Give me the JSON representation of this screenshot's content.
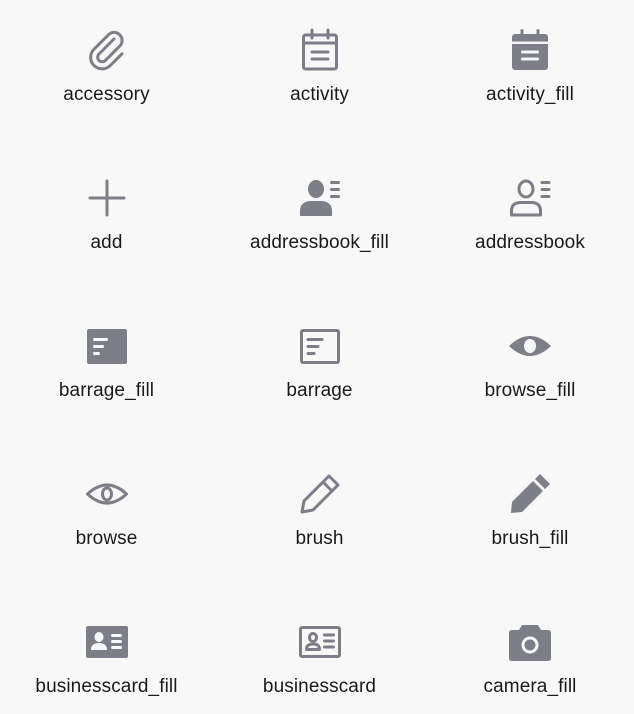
{
  "colors": {
    "background": "#f8f8f8",
    "icon": "#7d7e88",
    "label": "#1a1a1a"
  },
  "icons": [
    {
      "label": "accessory",
      "icon": "paperclip-icon"
    },
    {
      "label": "activity",
      "icon": "calendar-icon"
    },
    {
      "label": "activity_fill",
      "icon": "calendar-filled-icon"
    },
    {
      "label": "add",
      "icon": "plus-icon"
    },
    {
      "label": "addressbook_fill",
      "icon": "addressbook-filled-icon"
    },
    {
      "label": "addressbook",
      "icon": "addressbook-icon"
    },
    {
      "label": "barrage_fill",
      "icon": "barrage-filled-icon"
    },
    {
      "label": "barrage",
      "icon": "barrage-icon"
    },
    {
      "label": "browse_fill",
      "icon": "eye-filled-icon"
    },
    {
      "label": "browse",
      "icon": "eye-icon"
    },
    {
      "label": "brush",
      "icon": "pencil-icon"
    },
    {
      "label": "brush_fill",
      "icon": "pencil-filled-icon"
    },
    {
      "label": "businesscard_fill",
      "icon": "businesscard-filled-icon"
    },
    {
      "label": "businesscard",
      "icon": "businesscard-icon"
    },
    {
      "label": "camera_fill",
      "icon": "camera-filled-icon"
    }
  ]
}
